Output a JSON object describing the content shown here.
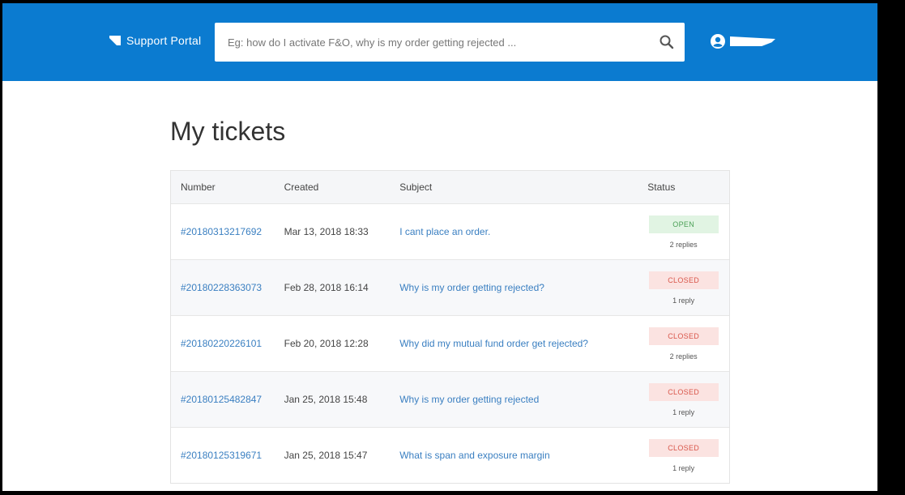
{
  "header": {
    "brand": "Support Portal",
    "search_placeholder": "Eg: how do I activate F&O, why is my order getting rejected ...",
    "colors": {
      "bar": "#0b7bd0"
    }
  },
  "main": {
    "title": "My tickets",
    "columns": {
      "number": "Number",
      "created": "Created",
      "subject": "Subject",
      "status": "Status"
    },
    "tickets": [
      {
        "number": "#20180313217692",
        "created": "Mar 13, 2018 18:33",
        "subject": "I cant place an order.",
        "status": "OPEN",
        "replies": "2 replies"
      },
      {
        "number": "#20180228363073",
        "created": "Feb 28, 2018 16:14",
        "subject": "Why is my order getting rejected?",
        "status": "CLOSED",
        "replies": "1 reply"
      },
      {
        "number": "#20180220226101",
        "created": "Feb 20, 2018 12:28",
        "subject": "Why did my mutual fund order get rejected?",
        "status": "CLOSED",
        "replies": "2 replies"
      },
      {
        "number": "#20180125482847",
        "created": "Jan 25, 2018 15:48",
        "subject": "Why is my order getting rejected",
        "status": "CLOSED",
        "replies": "1 reply"
      },
      {
        "number": "#20180125319671",
        "created": "Jan 25, 2018 15:47",
        "subject": "What is span and exposure margin",
        "status": "CLOSED",
        "replies": "1 reply"
      }
    ]
  }
}
